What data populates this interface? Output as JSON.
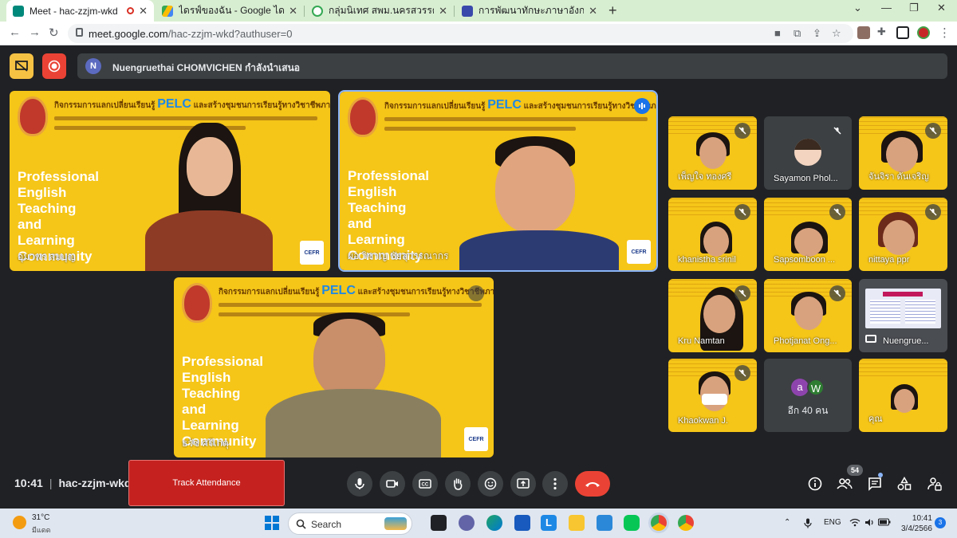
{
  "browser": {
    "tabs": [
      {
        "title": "Meet - hac-zzjm-wkd",
        "active": true
      },
      {
        "title": "ไดรฟ์ของฉัน - Google ไดรฟ์",
        "active": false
      },
      {
        "title": "กลุ่มนิเทศ สพม.นครสวรรค์",
        "active": false
      },
      {
        "title": "การพัฒนาทักษะภาษาอังกฤษ English",
        "active": false
      }
    ],
    "url_host": "meet.google.com",
    "url_path": "/hac-zzjm-wkd?authuser=0"
  },
  "meet": {
    "presenter_initial": "N",
    "presenter_text": "Nuengruethai CHOMVICHEN กำลังนำเสนอ",
    "banner": {
      "line1_prefix": "กิจกรรมการแลกเปลี่ยนเรียนรู้",
      "line1_brand": "PELC",
      "line1_suffix": "และสร้างชุมชนการเรียนรู้ทางวิชาชีพภาษาอังกฤษ",
      "big_text": [
        "Professional",
        "English",
        "Teaching",
        "and",
        "Learning",
        "Community"
      ],
      "badge": "CEFR"
    },
    "main_tiles": [
      {
        "name": "อุมาพร สมบุญ"
      },
      {
        "name": "ผอ.วิชาญ ชัยสุวรรณากร"
      },
      {
        "name": "ธวัช ศรีเกตุ"
      }
    ],
    "grid": [
      {
        "name": "เพ็ญใจ ทองศรี"
      },
      {
        "name": "Sayamon Phol..."
      },
      {
        "name": "จันจิรา ดันเจริญ"
      },
      {
        "name": "khanistha srinil"
      },
      {
        "name": "Sapsomboon ..."
      },
      {
        "name": "nittaya ppr"
      },
      {
        "name": "Kru Namtan"
      },
      {
        "name": "Photjanat Ong..."
      },
      {
        "name": "Nuengrue..."
      },
      {
        "name": "Khaokwan J."
      },
      {
        "name": "อีก 40 คน"
      },
      {
        "name": "คุณ"
      }
    ],
    "others_avatars": [
      "a",
      "W"
    ],
    "time": "10:41",
    "meeting_code": "hac-zzjm-wkd",
    "track_attendance": "Track Attendance",
    "participants_count": "54"
  },
  "taskbar": {
    "temp": "31°C",
    "weather_desc": "มีแดด",
    "search": "Search",
    "lang": "ENG",
    "time": "10:41",
    "date": "3/4/2566",
    "notifications": "3"
  }
}
